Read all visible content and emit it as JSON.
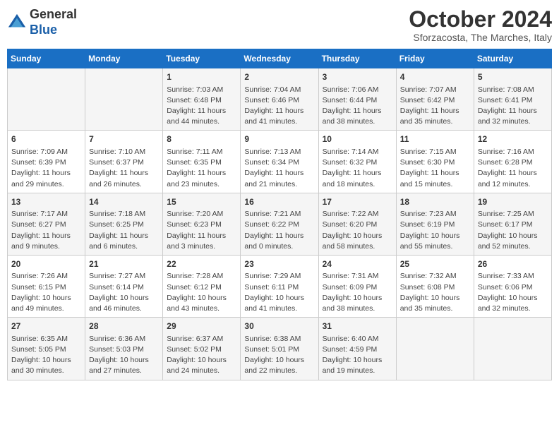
{
  "header": {
    "logo_general": "General",
    "logo_blue": "Blue",
    "month_title": "October 2024",
    "subtitle": "Sforzacosta, The Marches, Italy"
  },
  "weekdays": [
    "Sunday",
    "Monday",
    "Tuesday",
    "Wednesday",
    "Thursday",
    "Friday",
    "Saturday"
  ],
  "weeks": [
    [
      {
        "day": "",
        "content": ""
      },
      {
        "day": "",
        "content": ""
      },
      {
        "day": "1",
        "content": "Sunrise: 7:03 AM\nSunset: 6:48 PM\nDaylight: 11 hours and 44 minutes."
      },
      {
        "day": "2",
        "content": "Sunrise: 7:04 AM\nSunset: 6:46 PM\nDaylight: 11 hours and 41 minutes."
      },
      {
        "day": "3",
        "content": "Sunrise: 7:06 AM\nSunset: 6:44 PM\nDaylight: 11 hours and 38 minutes."
      },
      {
        "day": "4",
        "content": "Sunrise: 7:07 AM\nSunset: 6:42 PM\nDaylight: 11 hours and 35 minutes."
      },
      {
        "day": "5",
        "content": "Sunrise: 7:08 AM\nSunset: 6:41 PM\nDaylight: 11 hours and 32 minutes."
      }
    ],
    [
      {
        "day": "6",
        "content": "Sunrise: 7:09 AM\nSunset: 6:39 PM\nDaylight: 11 hours and 29 minutes."
      },
      {
        "day": "7",
        "content": "Sunrise: 7:10 AM\nSunset: 6:37 PM\nDaylight: 11 hours and 26 minutes."
      },
      {
        "day": "8",
        "content": "Sunrise: 7:11 AM\nSunset: 6:35 PM\nDaylight: 11 hours and 23 minutes."
      },
      {
        "day": "9",
        "content": "Sunrise: 7:13 AM\nSunset: 6:34 PM\nDaylight: 11 hours and 21 minutes."
      },
      {
        "day": "10",
        "content": "Sunrise: 7:14 AM\nSunset: 6:32 PM\nDaylight: 11 hours and 18 minutes."
      },
      {
        "day": "11",
        "content": "Sunrise: 7:15 AM\nSunset: 6:30 PM\nDaylight: 11 hours and 15 minutes."
      },
      {
        "day": "12",
        "content": "Sunrise: 7:16 AM\nSunset: 6:28 PM\nDaylight: 11 hours and 12 minutes."
      }
    ],
    [
      {
        "day": "13",
        "content": "Sunrise: 7:17 AM\nSunset: 6:27 PM\nDaylight: 11 hours and 9 minutes."
      },
      {
        "day": "14",
        "content": "Sunrise: 7:18 AM\nSunset: 6:25 PM\nDaylight: 11 hours and 6 minutes."
      },
      {
        "day": "15",
        "content": "Sunrise: 7:20 AM\nSunset: 6:23 PM\nDaylight: 11 hours and 3 minutes."
      },
      {
        "day": "16",
        "content": "Sunrise: 7:21 AM\nSunset: 6:22 PM\nDaylight: 11 hours and 0 minutes."
      },
      {
        "day": "17",
        "content": "Sunrise: 7:22 AM\nSunset: 6:20 PM\nDaylight: 10 hours and 58 minutes."
      },
      {
        "day": "18",
        "content": "Sunrise: 7:23 AM\nSunset: 6:19 PM\nDaylight: 10 hours and 55 minutes."
      },
      {
        "day": "19",
        "content": "Sunrise: 7:25 AM\nSunset: 6:17 PM\nDaylight: 10 hours and 52 minutes."
      }
    ],
    [
      {
        "day": "20",
        "content": "Sunrise: 7:26 AM\nSunset: 6:15 PM\nDaylight: 10 hours and 49 minutes."
      },
      {
        "day": "21",
        "content": "Sunrise: 7:27 AM\nSunset: 6:14 PM\nDaylight: 10 hours and 46 minutes."
      },
      {
        "day": "22",
        "content": "Sunrise: 7:28 AM\nSunset: 6:12 PM\nDaylight: 10 hours and 43 minutes."
      },
      {
        "day": "23",
        "content": "Sunrise: 7:29 AM\nSunset: 6:11 PM\nDaylight: 10 hours and 41 minutes."
      },
      {
        "day": "24",
        "content": "Sunrise: 7:31 AM\nSunset: 6:09 PM\nDaylight: 10 hours and 38 minutes."
      },
      {
        "day": "25",
        "content": "Sunrise: 7:32 AM\nSunset: 6:08 PM\nDaylight: 10 hours and 35 minutes."
      },
      {
        "day": "26",
        "content": "Sunrise: 7:33 AM\nSunset: 6:06 PM\nDaylight: 10 hours and 32 minutes."
      }
    ],
    [
      {
        "day": "27",
        "content": "Sunrise: 6:35 AM\nSunset: 5:05 PM\nDaylight: 10 hours and 30 minutes."
      },
      {
        "day": "28",
        "content": "Sunrise: 6:36 AM\nSunset: 5:03 PM\nDaylight: 10 hours and 27 minutes."
      },
      {
        "day": "29",
        "content": "Sunrise: 6:37 AM\nSunset: 5:02 PM\nDaylight: 10 hours and 24 minutes."
      },
      {
        "day": "30",
        "content": "Sunrise: 6:38 AM\nSunset: 5:01 PM\nDaylight: 10 hours and 22 minutes."
      },
      {
        "day": "31",
        "content": "Sunrise: 6:40 AM\nSunset: 4:59 PM\nDaylight: 10 hours and 19 minutes."
      },
      {
        "day": "",
        "content": ""
      },
      {
        "day": "",
        "content": ""
      }
    ]
  ]
}
